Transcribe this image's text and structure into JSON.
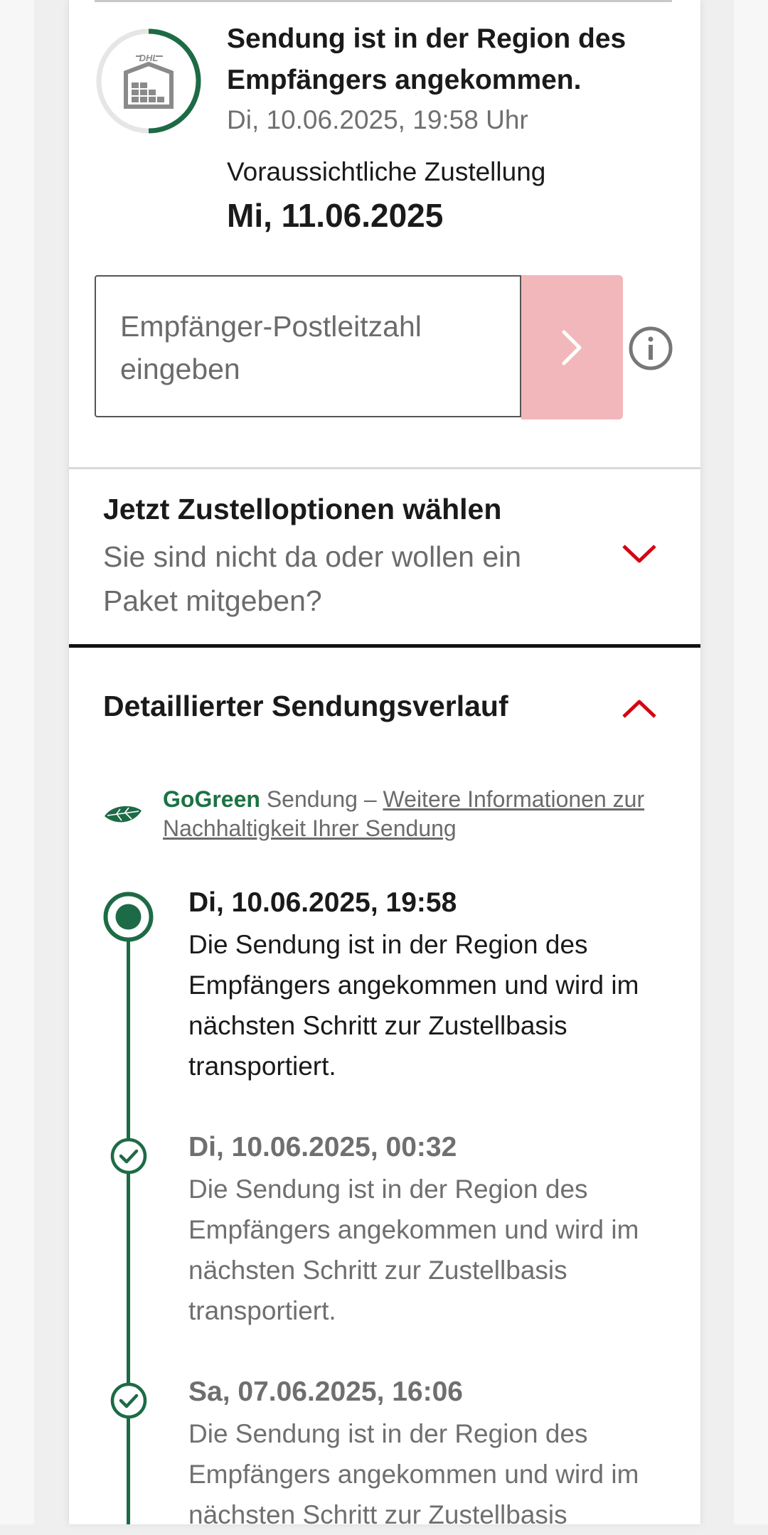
{
  "status": {
    "title": "Sendung ist in der Region des Empfängers angekommen.",
    "time": "Di, 10.06.2025, 19:58 Uhr",
    "eta_label": "Voraussichtliche Zustellung",
    "eta_date": "Mi, 11.06.2025",
    "icon_brand_text": "DHL",
    "progress_fraction": 0.6
  },
  "zip": {
    "placeholder": "Empfänger-Postleitzahl eingeben",
    "submit_icon": "chevron-right-icon",
    "info_icon": "info-icon"
  },
  "options": {
    "title": "Jetzt Zustelloptionen wählen",
    "description": "Sie sind nicht da oder wollen ein Paket mitgeben?",
    "expanded": false
  },
  "history": {
    "title": "Detaillierter Sendungsverlauf",
    "expanded": true,
    "gogreen_brand": "GoGreen",
    "gogreen_text": " Sendung – ",
    "gogreen_link": "Weitere Informationen zur Nachhaltigkeit Ihrer Sendung",
    "events": [
      {
        "date": "Di, 10.06.2025, 19:58",
        "text": "Die Sendung ist in der Region des Empfängers angekommen und wird im nächsten Schritt zur Zustellbasis transportiert.",
        "state": "current"
      },
      {
        "date": "Di, 10.06.2025, 00:32",
        "text": "Die Sendung ist in der Region des Empfängers angekommen und wird im nächsten Schritt zur Zustellbasis transportiert.",
        "state": "done"
      },
      {
        "date": "Sa, 07.06.2025, 16:06",
        "text": "Die Sendung ist in der Region des Empfängers angekommen und wird im nächsten Schritt zur Zustellbasis",
        "state": "done"
      }
    ]
  },
  "colors": {
    "dhl_red": "#d40511",
    "green": "#1d6b46",
    "submit_disabled": "#f2b7ba"
  }
}
